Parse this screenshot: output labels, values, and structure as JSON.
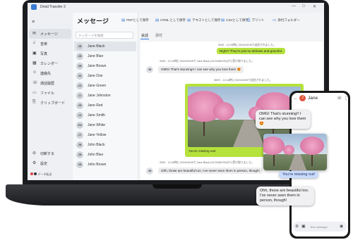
{
  "app": {
    "title": "Droid Transfer 2",
    "window_controls": [
      "—",
      "□",
      "✕"
    ]
  },
  "sidebar": {
    "items": [
      {
        "label": "メッセージ",
        "icon": "chat-icon",
        "glyph": "✉"
      },
      {
        "label": "音楽",
        "icon": "music-icon",
        "glyph": "♫"
      },
      {
        "label": "写真",
        "icon": "photo-icon",
        "glyph": "▣"
      },
      {
        "label": "カレンダー",
        "icon": "calendar-icon",
        "glyph": "▦"
      },
      {
        "label": "連絡先",
        "icon": "contacts-icon",
        "glyph": "☺"
      },
      {
        "label": "通話履歴",
        "icon": "phone-icon",
        "glyph": "☏"
      },
      {
        "label": "ファイル",
        "icon": "folder-icon",
        "glyph": "▭"
      },
      {
        "label": "クリップボード",
        "icon": "clipboard-icon",
        "glyph": "⎘"
      }
    ],
    "bottom": [
      {
        "label": "切断する",
        "icon": "unlink-icon",
        "glyph": "⊘"
      },
      {
        "label": "設定",
        "icon": "gear-icon",
        "glyph": "⚙"
      }
    ],
    "status": "データ転送"
  },
  "messages": {
    "page_title": "メッセージ",
    "search_placeholder": "メッセージを検索",
    "tabs": [
      "会話",
      "添付"
    ],
    "toolbar": [
      {
        "label": "PDFとして保存"
      },
      {
        "label": "HTML として保存"
      },
      {
        "label": "テキストとして保存"
      },
      {
        "label": "CSVとして保存"
      },
      {
        "label": "プリント"
      },
      {
        "label": "添付フォルダー"
      }
    ]
  },
  "contacts": [
    {
      "initials": "JB",
      "name": "Jane Black"
    },
    {
      "initials": "JB",
      "name": "Jane Blue"
    },
    {
      "initials": "JB",
      "name": "Jane Brown"
    },
    {
      "initials": "JD",
      "name": "Jane Doe"
    },
    {
      "initials": "JG",
      "name": "Jane Green"
    },
    {
      "initials": "JJ",
      "name": "Jane Johnston"
    },
    {
      "initials": "JR",
      "name": "Jane Red"
    },
    {
      "initials": "JS",
      "name": "Jane Smith"
    },
    {
      "initials": "JW",
      "name": "Jane White"
    },
    {
      "initials": "JY",
      "name": "Jane Yellow"
    },
    {
      "initials": "JB",
      "name": "John Black"
    },
    {
      "initials": "JB",
      "name": "John Blue"
    },
    {
      "initials": "JB",
      "name": "John Brown"
    }
  ],
  "conversation": {
    "m1_meta": "SMS - 12:43時に2024/04/08で送信されました。",
    "m1_text": "Right? They're just so delicate and graceful.",
    "m2_meta": "SMS - 12:43時に2024/04/08で Jane Black (0123456789)から受け取りました。",
    "m2_avatar": "JB",
    "m2_text": "OMG! That's stunning!! I can see why you love them 😍",
    "m3_meta": "MMS - 12:44時に2024/04/08で送信されました。",
    "m3_caption": "You're missing out!",
    "m4_meta": "SMS - 12:45時に2024/04/08で Jane Black (0123456789)から受け取りました。",
    "m4_avatar": "JB",
    "m4_text": "Ohh, those are beautiful too. I've never seen them in person, though!"
  },
  "phone": {
    "contact_initial": "J",
    "contact_name": "Jane",
    "bubble1": "OMG! That's stunning!! I can see why you love them 😍",
    "caption": "You're missing out!",
    "bubble2": "Ohh, those are beautiful too. I've never seen them in person, though!",
    "input_placeholder": "Text message"
  },
  "colors": {
    "accent": "#2d7be5",
    "sent_bubble": "#b5e23c",
    "phone_sent": "#c9dbff"
  }
}
